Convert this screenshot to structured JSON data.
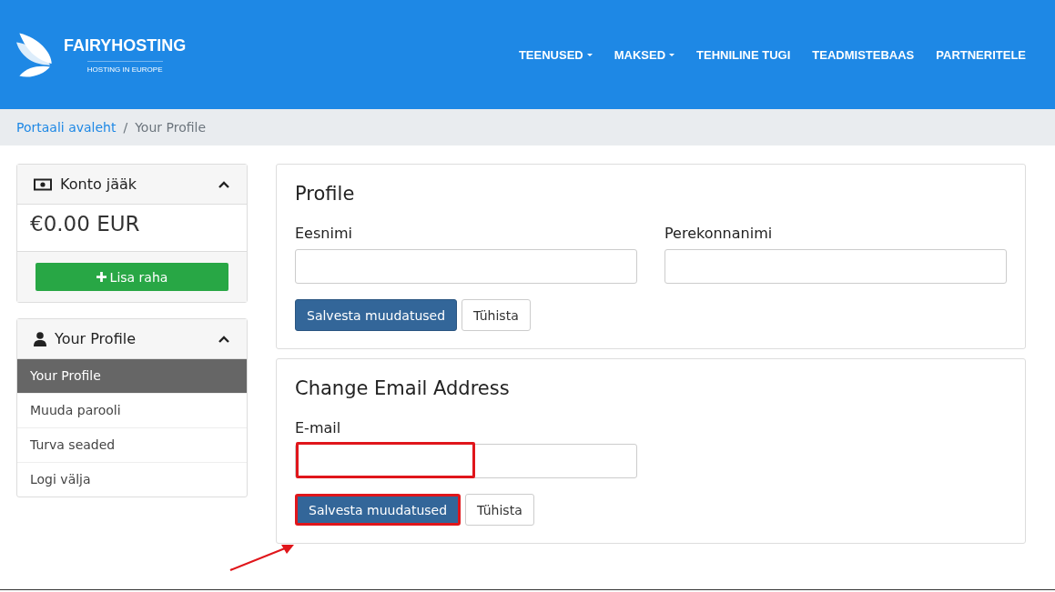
{
  "brand": {
    "name": "FAIRYHOSTING",
    "tagline": "HOSTING IN EUROPE"
  },
  "nav": [
    {
      "label": "TEENUSED",
      "has_caret": true
    },
    {
      "label": "MAKSED",
      "has_caret": true
    },
    {
      "label": "TEHNILINE TUGI",
      "has_caret": false
    },
    {
      "label": "TEADMISTEBAAS",
      "has_caret": false
    },
    {
      "label": "PARTNERITELE",
      "has_caret": false
    }
  ],
  "breadcrumb": [
    {
      "label": "Portaali avaleht",
      "kind": "link"
    },
    {
      "label": "/",
      "kind": "separator"
    },
    {
      "label": "Your Profile",
      "kind": "current"
    }
  ],
  "balance_panel": {
    "title": "Konto jääk",
    "expanded": true,
    "amount": "€0.00 EUR",
    "button": "Lisa raha"
  },
  "profile_panel": {
    "title": "Your Profile",
    "expanded": true,
    "items": [
      {
        "label": "Your Profile",
        "selected": true
      },
      {
        "label": "Muuda parooli",
        "selected": false
      },
      {
        "label": "Turva seaded",
        "selected": false
      },
      {
        "label": "Logi välja",
        "selected": false
      }
    ]
  },
  "forms": [
    {
      "title": "Profile",
      "fields": [
        {
          "label": "Eesnimi",
          "highlighted": false
        },
        {
          "label": "Perekonnanimi",
          "highlighted": false
        }
      ],
      "save": "Salvesta muudatused",
      "save_highlighted": false,
      "cancel": "Tühista"
    },
    {
      "title": "Change Email Address",
      "fields": [
        {
          "label": "E-mail",
          "highlighted": true
        }
      ],
      "save": "Salvesta muudatused",
      "save_highlighted": true,
      "cancel": "Tühista"
    }
  ],
  "annotation_arrow": true
}
